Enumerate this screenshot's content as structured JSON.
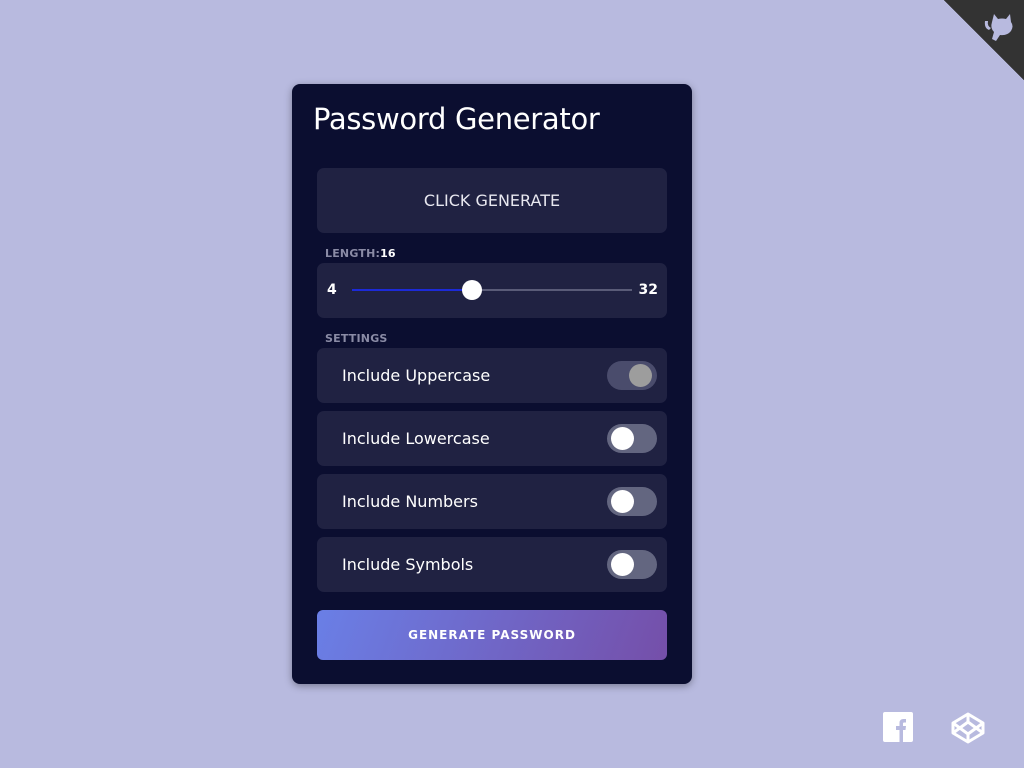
{
  "app": {
    "title": "Password Generator"
  },
  "result": {
    "text": "CLICK GENERATE"
  },
  "length": {
    "label": "LENGTH:",
    "value": "16",
    "min": "4",
    "max": "32",
    "current": 16
  },
  "settings": {
    "label": "SETTINGS",
    "items": [
      {
        "label": "Include Uppercase",
        "checked": true
      },
      {
        "label": "Include Lowercase",
        "checked": false
      },
      {
        "label": "Include Numbers",
        "checked": false
      },
      {
        "label": "Include Symbols",
        "checked": false
      }
    ]
  },
  "actions": {
    "generate_label": "GENERATE PASSWORD"
  },
  "colors": {
    "page_bg": "#b8badf",
    "card_bg": "#0b0e30",
    "panel_bg": "#202242",
    "slider_fill": "#1c2ad8",
    "button_gradient_start": "#6a7fe6",
    "button_gradient_end": "#754fa9"
  },
  "icons": {
    "corner": "github-octocat-icon",
    "social": [
      "facebook-icon",
      "codepen-icon"
    ]
  }
}
